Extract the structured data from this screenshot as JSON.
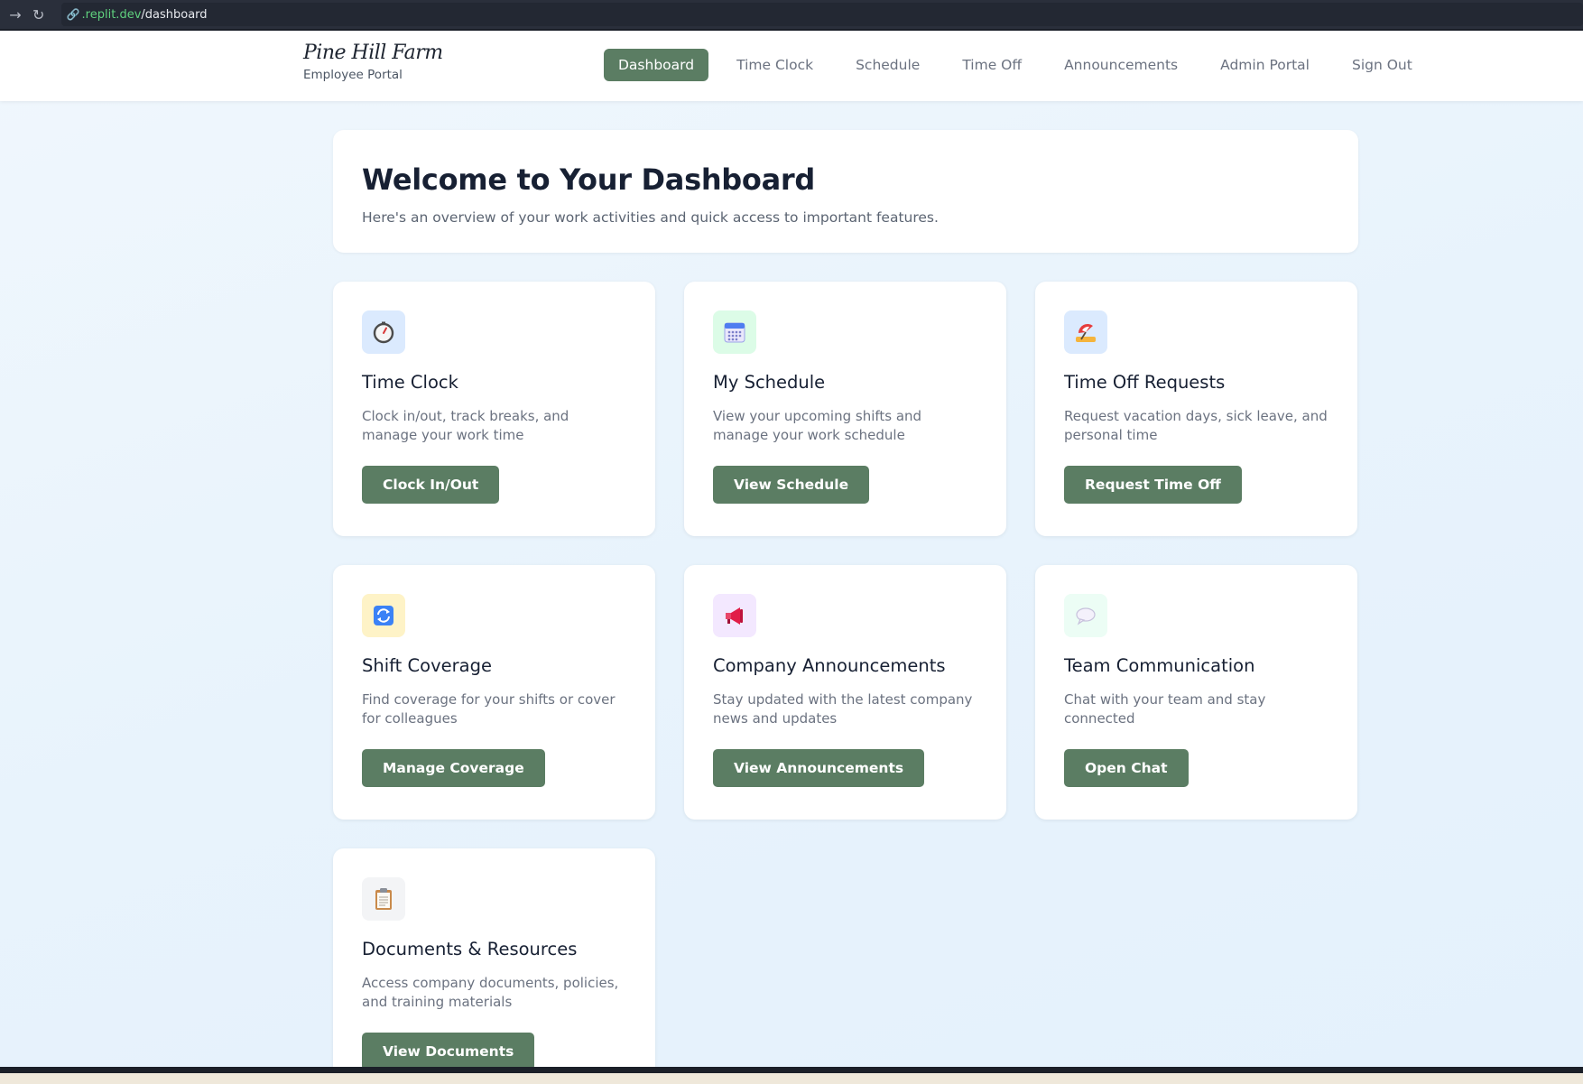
{
  "browser": {
    "back_glyph": "→",
    "reload_glyph": "↻",
    "url_host": ".replit.dev",
    "url_path": "/dashboard"
  },
  "brand": {
    "logo_text": "Pine Hill Farm",
    "subtitle": "Employee Portal"
  },
  "nav": {
    "items": [
      {
        "label": "Dashboard",
        "active": true
      },
      {
        "label": "Time Clock",
        "active": false
      },
      {
        "label": "Schedule",
        "active": false
      },
      {
        "label": "Time Off",
        "active": false
      },
      {
        "label": "Announcements",
        "active": false
      },
      {
        "label": "Admin Portal",
        "active": false
      },
      {
        "label": "Sign Out",
        "active": false
      }
    ]
  },
  "welcome": {
    "title": "Welcome to Your Dashboard",
    "subtitle": "Here's an overview of your work activities and quick access to important features."
  },
  "cards": [
    {
      "icon": "stopwatch-icon",
      "icon_bg": "#dbeafe",
      "title": "Time Clock",
      "desc": "Clock in/out, track breaks, and manage your work time",
      "button": "Clock In/Out"
    },
    {
      "icon": "calendar-icon",
      "icon_bg": "#dcfce7",
      "title": "My Schedule",
      "desc": "View your upcoming shifts and manage your work schedule",
      "button": "View Schedule"
    },
    {
      "icon": "beach-umbrella-icon",
      "icon_bg": "#dbeafe",
      "title": "Time Off Requests",
      "desc": "Request vacation days, sick leave, and personal time",
      "button": "Request Time Off"
    },
    {
      "icon": "swap-arrows-icon",
      "icon_bg": "#fef3c7",
      "title": "Shift Coverage",
      "desc": "Find coverage for your shifts or cover for colleagues",
      "button": "Manage Coverage"
    },
    {
      "icon": "megaphone-icon",
      "icon_bg": "#f3e8ff",
      "title": "Company Announcements",
      "desc": "Stay updated with the latest company news and updates",
      "button": "View Announcements"
    },
    {
      "icon": "speech-bubble-icon",
      "icon_bg": "#ecfdf5",
      "title": "Team Communication",
      "desc": "Chat with your team and stay connected",
      "button": "Open Chat"
    },
    {
      "icon": "clipboard-icon",
      "icon_bg": "#f3f4f6",
      "title": "Documents & Resources",
      "desc": "Access company documents, policies, and training materials",
      "button": "View Documents"
    }
  ],
  "colors": {
    "accent": "#5b7d63",
    "page_bg": "#e8f3fc",
    "title_text": "#172033",
    "muted_text": "#6b7280"
  }
}
